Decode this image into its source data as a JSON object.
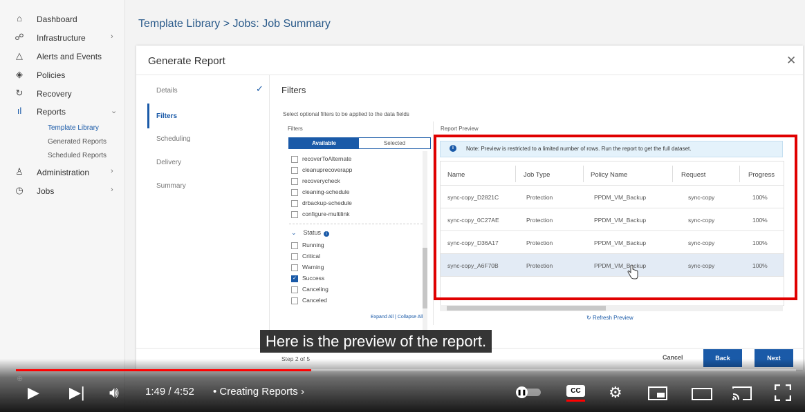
{
  "sidebar": {
    "items": [
      {
        "label": "Dashboard",
        "icon": "home-icon"
      },
      {
        "label": "Infrastructure",
        "icon": "network-icon"
      },
      {
        "label": "Alerts and Events",
        "icon": "bell-icon"
      },
      {
        "label": "Policies",
        "icon": "shield-icon"
      },
      {
        "label": "Recovery",
        "icon": "refresh-icon"
      },
      {
        "label": "Reports",
        "icon": "bar-chart-icon"
      },
      {
        "label": "Administration",
        "icon": "user-icon"
      },
      {
        "label": "Jobs",
        "icon": "clock-icon"
      }
    ],
    "report_subitems": [
      "Template Library",
      "Generated Reports",
      "Scheduled Reports"
    ]
  },
  "header": {
    "title": "Template Library > Jobs:  Job Summary"
  },
  "modal": {
    "title": "Generate Report",
    "steps": [
      "Details",
      "Filters",
      "Scheduling",
      "Delivery",
      "Summary"
    ],
    "section_title": "Filters",
    "description": "Select optional filters to be applied to the data fields",
    "filters": {
      "heading": "Filters",
      "tab_available": "Available",
      "tab_selected": "Selected",
      "policy_items": [
        "recoverToAlternate",
        "cleanuprecoverapp",
        "recoverycheck",
        "cleaning-schedule",
        "drbackup-schedule",
        "configure-multilink"
      ],
      "status_label": "Status",
      "status_items": [
        {
          "label": "Running",
          "checked": false
        },
        {
          "label": "Critical",
          "checked": false
        },
        {
          "label": "Warning",
          "checked": false
        },
        {
          "label": "Success",
          "checked": true
        },
        {
          "label": "Canceling",
          "checked": false
        },
        {
          "label": "Canceled",
          "checked": false
        }
      ],
      "expand_all": "Expand All",
      "collapse_all": "Collapse All"
    },
    "preview": {
      "heading": "Report Preview",
      "note": "Note: Preview is restricted to a limited number of rows. Run the report to get the full dataset.",
      "columns": [
        "Name",
        "Job Type",
        "Policy Name",
        "Request",
        "Progress"
      ],
      "rows": [
        [
          "sync-copy_D2821C",
          "Protection",
          "PPDM_VM_Backup",
          "sync-copy",
          "100%"
        ],
        [
          "sync-copy_0C27AE",
          "Protection",
          "PPDM_VM_Backup",
          "sync-copy",
          "100%"
        ],
        [
          "sync-copy_D36A17",
          "Protection",
          "PPDM_VM_Backup",
          "sync-copy",
          "100%"
        ],
        [
          "sync-copy_A6F70B",
          "Protection",
          "PPDM_VM_Backup",
          "sync-copy",
          "100%"
        ]
      ],
      "refresh": "Refresh Preview"
    },
    "footer": {
      "step": "Step 2 of 5",
      "cancel": "Cancel",
      "back": "Back",
      "next": "Next"
    }
  },
  "caption": "Here is the preview of the report.",
  "player": {
    "current_time": "1:49",
    "duration": "4:52",
    "time_display": "1:49 / 4:52",
    "chapter": "Creating Reports",
    "progress": 0.3784,
    "cc_label": "CC",
    "accent_color": "#ff0000"
  }
}
